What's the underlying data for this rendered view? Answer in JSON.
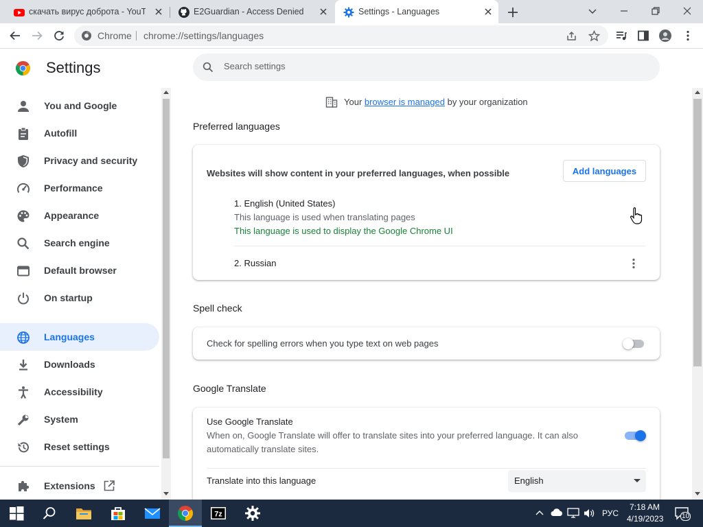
{
  "window": {
    "tabs": [
      {
        "title": "скачать вирус доброта - YouTube",
        "icon": "youtube-icon"
      },
      {
        "title": "E2Guardian - Access Denied",
        "icon": "github-icon"
      },
      {
        "title": "Settings - Languages",
        "icon": "gear-icon"
      }
    ],
    "active_tab": 2
  },
  "toolbar": {
    "chip": "Chrome",
    "url": "chrome://settings/languages"
  },
  "settings": {
    "title": "Settings",
    "search_placeholder": "Search settings"
  },
  "sidebar": {
    "items": [
      {
        "label": "You and Google",
        "icon": "person-icon"
      },
      {
        "label": "Autofill",
        "icon": "clipboard-icon"
      },
      {
        "label": "Privacy and security",
        "icon": "shield-icon"
      },
      {
        "label": "Performance",
        "icon": "speedometer-icon"
      },
      {
        "label": "Appearance",
        "icon": "palette-icon"
      },
      {
        "label": "Search engine",
        "icon": "search-icon"
      },
      {
        "label": "Default browser",
        "icon": "browser-window-icon"
      },
      {
        "label": "On startup",
        "icon": "power-icon"
      },
      {
        "label": "Languages",
        "icon": "globe-icon",
        "selected": true
      },
      {
        "label": "Downloads",
        "icon": "download-icon"
      },
      {
        "label": "Accessibility",
        "icon": "accessibility-icon"
      },
      {
        "label": "System",
        "icon": "wrench-icon"
      },
      {
        "label": "Reset settings",
        "icon": "reset-history-icon"
      },
      {
        "label": "Extensions",
        "icon": "puzzle-icon"
      }
    ]
  },
  "managed": {
    "prefix": "Your",
    "link": "browser is managed",
    "suffix": "by your organization"
  },
  "preferred": {
    "section_title": "Preferred languages",
    "description": "Websites will show content in your preferred languages, when possible",
    "add_button": "Add languages",
    "languages": [
      {
        "name": "1. English (United States)",
        "note1": "This language is used when translating pages",
        "note2": "This language is used to display the Google Chrome UI"
      },
      {
        "name": "2. Russian"
      }
    ]
  },
  "spell": {
    "section_title": "Spell check",
    "label": "Check for spelling errors when you type text on web pages",
    "enabled": false
  },
  "translate": {
    "section_title": "Google Translate",
    "title": "Use Google Translate",
    "desc1": "When on, Google Translate will offer to translate sites into your preferred language. It can also",
    "desc2": "automatically translate sites.",
    "enabled": true,
    "into_label": "Translate into this language",
    "into_value": "English"
  },
  "taskbar": {
    "lang": "РУС",
    "time": "7:18 AM",
    "date": "4/19/2023",
    "notifications": "10"
  },
  "colors": {
    "accent": "#1a73e8",
    "green_text": "#188038",
    "taskbar": "#1c2a40"
  }
}
